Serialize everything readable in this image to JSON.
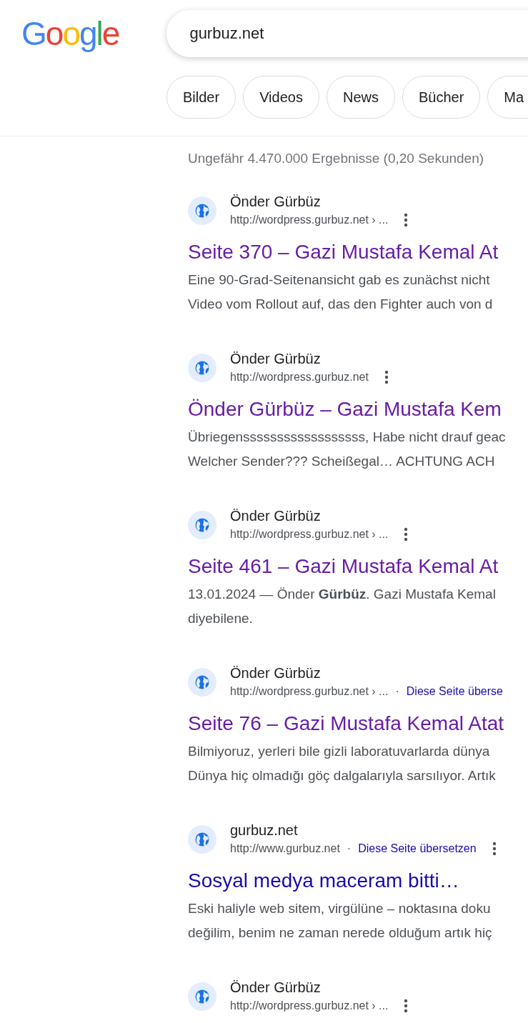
{
  "logo": "Google",
  "search": {
    "value": "gurbuz.net"
  },
  "chips": [
    "Bilder",
    "Videos",
    "News",
    "Bücher",
    "Ma"
  ],
  "stats": "Ungefähr 4.470.000 Ergebnisse (0,20 Sekunden)",
  "results": [
    {
      "site": "Önder Gürbüz",
      "url": "http://wordpress.gurbuz.net › ...",
      "menu": true,
      "title": "Seite 370 – Gazi Mustafa Kemal At",
      "visited": true,
      "snippet": [
        "Eine 90-Grad-Seitenansicht gab es zunächst nicht",
        "Video vom Rollout auf, das den Fighter auch von d"
      ]
    },
    {
      "site": "Önder Gürbüz",
      "url": "http://wordpress.gurbuz.net",
      "menu": true,
      "title": "Önder Gürbüz – Gazi Mustafa Kem",
      "visited": true,
      "snippet": [
        "Übriegenssssssssssssssssss, Habe nicht drauf geac",
        "Welcher Sender??? Scheißegal… ACHTUNG ACH"
      ]
    },
    {
      "site": "Önder Gürbüz",
      "url": "http://wordpress.gurbuz.net › ...",
      "menu": true,
      "title": "Seite 461 – Gazi Mustafa Kemal At",
      "visited": true,
      "snippet": [
        "13.01.2024 — Önder **Gürbüz**. Gazi Mustafa Kemal",
        "diyebilene."
      ]
    },
    {
      "site": "Önder Gürbüz",
      "url": "http://wordpress.gurbuz.net › ...",
      "separator": "·",
      "translate": "Diese Seite überse",
      "menu": false,
      "title": "Seite 76 – Gazi Mustafa Kemal Atat",
      "visited": true,
      "snippet": [
        "Bilmiyoruz, yerleri bile gizli laboratuvarlarda dünya",
        "Dünya hiç olmadığı göç dalgalarıyla sarsılıyor. Artık"
      ]
    },
    {
      "site": "gurbuz.net",
      "url": "http://www.gurbuz.net",
      "separator": "·",
      "translate": "Diese Seite übersetzen",
      "menu": true,
      "title": "Sosyal medya maceram bitti…",
      "visited": false,
      "snippet": [
        "Eski haliyle web sitem, virgülüne – noktasına doku",
        "değilim, benim ne zaman nerede olduğum artık hiç"
      ]
    },
    {
      "site": "Önder Gürbüz",
      "url": "http://wordpress.gurbuz.net › ...",
      "menu": true
    }
  ]
}
